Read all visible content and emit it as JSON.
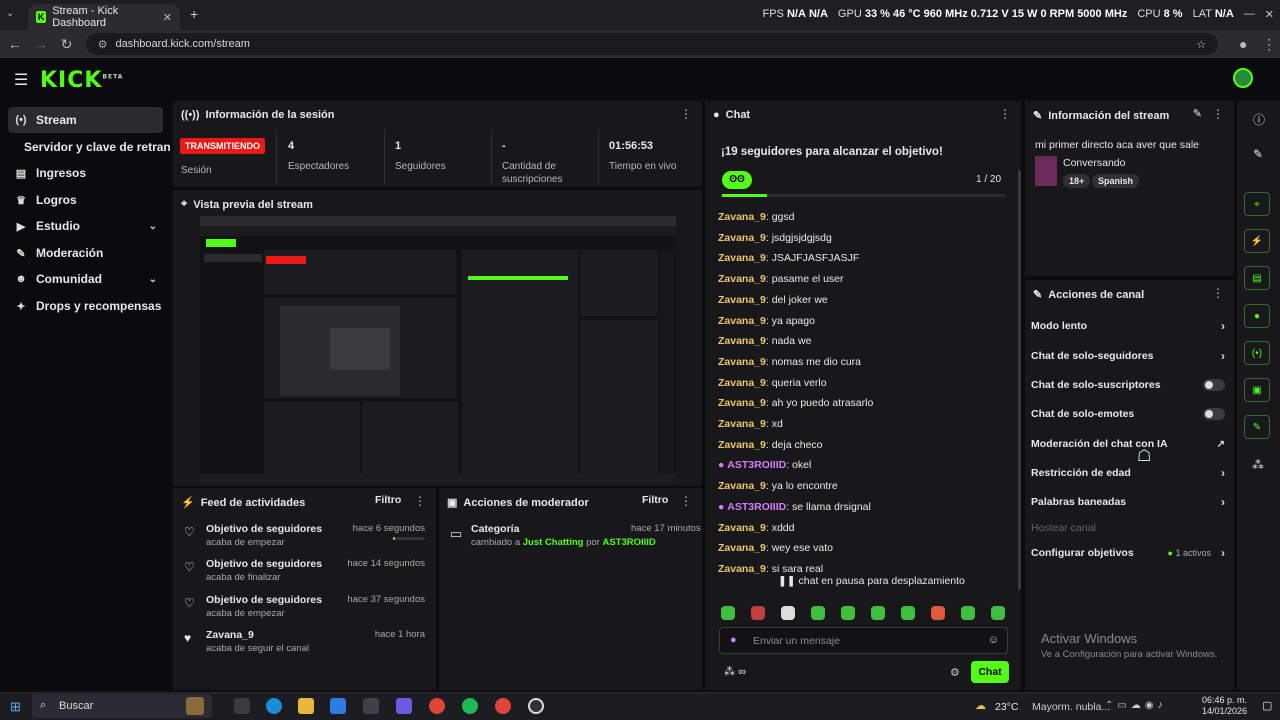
{
  "browser": {
    "tab_title": "Stream - Kick Dashboard",
    "url": "dashboard.kick.com/stream",
    "perf": {
      "fps_label": "FPS",
      "fps1": "N/A",
      "fps2": "N/A",
      "gpu_label": "GPU",
      "gpu_pct": "33 %",
      "gpu_temp": "46 °C",
      "gpu_mhz": "960 MHz",
      "gpu_v": "0.712 V",
      "gpu_w": "15 W",
      "gpu_rpm": "0 RPM",
      "gpu_mem": "5000 MHz",
      "cpu_label": "CPU",
      "cpu_pct": "8 %",
      "lat_label": "LAT",
      "lat_val": "N/A"
    }
  },
  "brand": {
    "logo": "KICK",
    "beta": "BETA",
    "accent": "#53fc18"
  },
  "sidebar": {
    "items": [
      {
        "label": "Stream",
        "icon": "broadcast-icon"
      },
      {
        "label": "Servidor y clave de retransm",
        "icon": ""
      },
      {
        "label": "Ingresos",
        "icon": "chart-icon"
      },
      {
        "label": "Logros",
        "icon": "trophy-icon"
      },
      {
        "label": "Estudio",
        "icon": "video-icon"
      },
      {
        "label": "Moderación",
        "icon": "wrench-icon"
      },
      {
        "label": "Comunidad",
        "icon": "people-icon"
      },
      {
        "label": "Drops y recompensas",
        "icon": "gift-icon"
      }
    ]
  },
  "session": {
    "title": "Información de la sesión",
    "live_badge": "TRANSMITIENDO",
    "session_label": "Sesión",
    "viewers": "4",
    "viewers_label": "Espectadores",
    "followers": "1",
    "followers_label": "Seguidores",
    "subs": "-",
    "subs_label_1": "Cantidad de",
    "subs_label_2": "suscripciones",
    "time": "01:56:53",
    "time_label": "Tiempo en vivo"
  },
  "preview": {
    "title": "Vista previa del stream"
  },
  "feed": {
    "title": "Feed de actividades",
    "filter": "Filtro",
    "items": [
      {
        "title": "Objetivo de seguidores",
        "sub": "acaba de empezar",
        "time": "hace 6 segundos",
        "progress": 0.05
      },
      {
        "title": "Objetivo de seguidores",
        "sub": "acaba de finalizar",
        "time": "hace 14 segundos"
      },
      {
        "title": "Objetivo de seguidores",
        "sub": "acaba de empezar",
        "time": "hace 37 segundos"
      },
      {
        "title": "Zavana_9",
        "sub": "acaba de seguir el canal",
        "time": "hace 1 hora"
      }
    ]
  },
  "modactions": {
    "title": "Acciones de moderador",
    "filter": "Filtro",
    "item_title": "Categoría",
    "item_time": "hace 17 minutos",
    "item_pre": "cambiado a",
    "item_cat": "Just Chatting",
    "item_mid": "por",
    "item_user": "AST3ROIIID"
  },
  "chat": {
    "title": "Chat",
    "goal": "¡19 seguidores para alcanzar el objetivo!",
    "goal_count": "1 / 20",
    "goal_progress": 0.05,
    "messages": [
      {
        "user": "Zavana_9",
        "text": "ggsd",
        "color": "#f0c66a"
      },
      {
        "user": "Zavana_9",
        "text": "jsdgjsjdgjsdg",
        "color": "#f0c66a"
      },
      {
        "user": "Zavana_9",
        "text": "JSAJFJASFJASJF",
        "color": "#f0c66a"
      },
      {
        "user": "Zavana_9",
        "text": "pasame el user",
        "color": "#f0c66a"
      },
      {
        "user": "Zavana_9",
        "text": "del joker we",
        "color": "#f0c66a"
      },
      {
        "user": "Zavana_9",
        "text": "ya apago",
        "color": "#f0c66a"
      },
      {
        "user": "Zavana_9",
        "text": "nada we",
        "color": "#f0c66a"
      },
      {
        "user": "Zavana_9",
        "text": "nomas me dio cura",
        "color": "#f0c66a"
      },
      {
        "user": "Zavana_9",
        "text": "queria verlo",
        "color": "#f0c66a"
      },
      {
        "user": "Zavana_9",
        "text": "ah yo puedo atrasarlo",
        "color": "#f0c66a"
      },
      {
        "user": "Zavana_9",
        "text": "xd",
        "color": "#f0c66a"
      },
      {
        "user": "Zavana_9",
        "text": "deja checo",
        "color": "#f0c66a"
      },
      {
        "user": "AST3ROIIID",
        "text": "okel",
        "color": "#d67bff"
      },
      {
        "user": "Zavana_9",
        "text": "ya lo encontre",
        "color": "#f0c66a"
      },
      {
        "user": "AST3ROIIID",
        "text": "se llama drsignal",
        "color": "#d67bff"
      },
      {
        "user": "Zavana_9",
        "text": "xddd",
        "color": "#f0c66a"
      },
      {
        "user": "Zavana_9",
        "text": "wey ese vato",
        "color": "#f0c66a"
      },
      {
        "user": "Zavana_9",
        "text": "si sara real",
        "color": "#f0c66a"
      }
    ],
    "paused": "chat en pausa para desplazamiento",
    "input_placeholder": "Enviar un mensaje",
    "send": "Chat",
    "points": "∞"
  },
  "stream_info": {
    "title": "Información del stream",
    "stream_title": "mi primer directo aca aver que sale",
    "category": "Conversando",
    "tag_age": "18+",
    "tag_lang": "Spanish"
  },
  "channel_actions": {
    "title": "Acciones de canal",
    "items": [
      {
        "label": "Modo lento"
      },
      {
        "label": "Chat de solo-seguidores"
      },
      {
        "label": "Chat de solo-suscriptores"
      },
      {
        "label": "Chat de solo-emotes"
      },
      {
        "label": "Moderación del chat con IA"
      },
      {
        "label": "Restricción de edad"
      },
      {
        "label": "Palabras baneadas"
      },
      {
        "label": "Hostear canal"
      },
      {
        "label": "Configurar objetivos"
      }
    ],
    "goals_active": "1 activos"
  },
  "watermark": {
    "line1": "Activar Windows",
    "line2": "Ve a Configuración para activar Windows."
  },
  "taskbar": {
    "search": "Buscar",
    "weather": "23°C",
    "weather_desc": "Mayorm. nubla...",
    "time": "06:46 p. m.",
    "date": "14/01/2026"
  }
}
